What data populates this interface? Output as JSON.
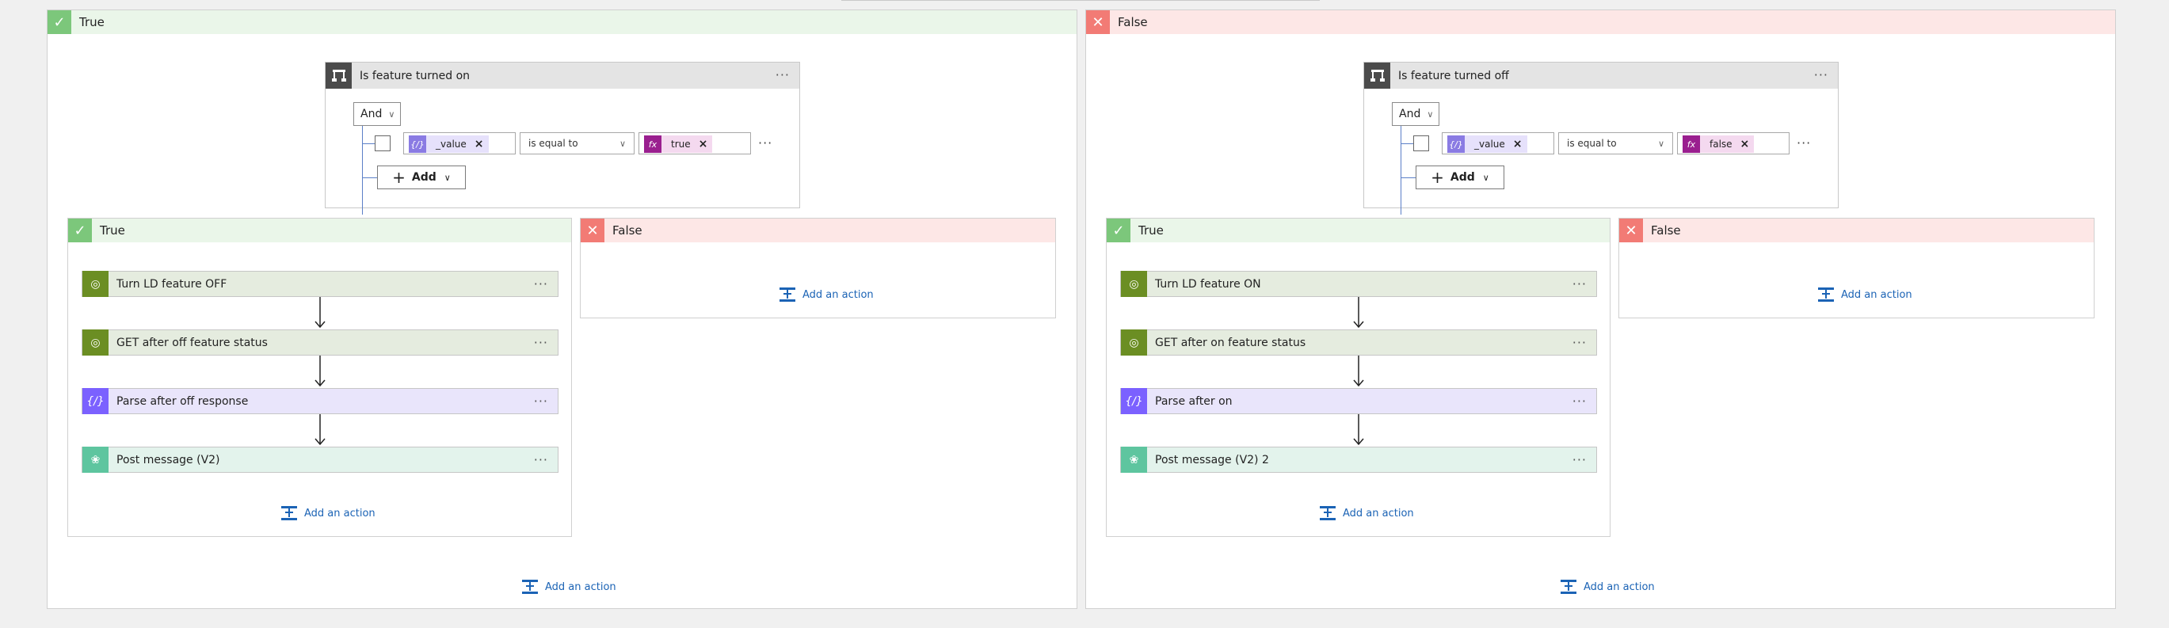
{
  "outer_true": {
    "label": "True",
    "condition": {
      "title": "Is feature turned on",
      "group_operator": "And",
      "row": {
        "left_token": "_value",
        "operator": "is equal to",
        "right_token": "true"
      },
      "add_label": "Add"
    },
    "inner_true": {
      "label": "True",
      "actions": [
        {
          "title": "Turn LD feature OFF",
          "kind": "ld"
        },
        {
          "title": "GET after off feature status",
          "kind": "ld"
        },
        {
          "title": "Parse after off response",
          "kind": "parse"
        },
        {
          "title": "Post message (V2)",
          "kind": "teams"
        }
      ],
      "add_action": "Add an action"
    },
    "inner_false": {
      "label": "False",
      "add_action": "Add an action"
    },
    "add_action": "Add an action"
  },
  "outer_false": {
    "label": "False",
    "condition": {
      "title": "Is feature turned off",
      "group_operator": "And",
      "row": {
        "left_token": "_value",
        "operator": "is equal to",
        "right_token": "false"
      },
      "add_label": "Add"
    },
    "inner_true": {
      "label": "True",
      "actions": [
        {
          "title": "Turn LD feature ON",
          "kind": "ld"
        },
        {
          "title": "GET after on feature status",
          "kind": "ld"
        },
        {
          "title": "Parse after on",
          "kind": "parse"
        },
        {
          "title": "Post message (V2) 2",
          "kind": "teams"
        }
      ],
      "add_action": "Add an action"
    },
    "inner_false": {
      "label": "False",
      "add_action": "Add an action"
    },
    "add_action": "Add an action"
  },
  "icons": {
    "true_branch": "check-icon",
    "false_branch": "close-icon",
    "condition": "condition-icon",
    "ld_action": "launchdarkly-icon",
    "parse_action": "parse-json-icon",
    "teams_action": "teams-icon",
    "add_action": "add-action-icon",
    "more": "more-dots-icon"
  },
  "colors": {
    "true_header": "#eaf6e9",
    "true_accent": "#7cc77b",
    "false_header": "#fde7e6",
    "false_accent": "#f27b75",
    "link": "#1b63b5",
    "ld": "#6b8e23",
    "parse": "#7b61ff",
    "teams": "#5ec59f",
    "fx_token": "#9a1f8f"
  }
}
